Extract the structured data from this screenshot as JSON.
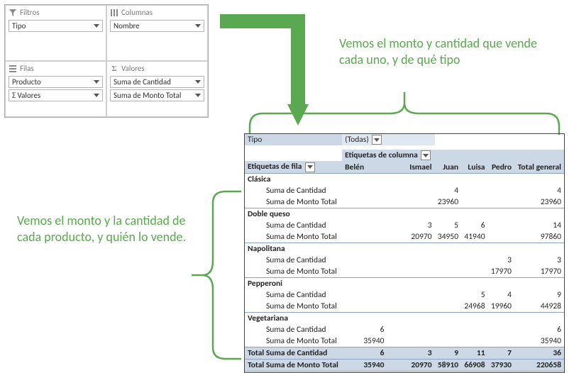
{
  "fieldlist": {
    "zones": {
      "filters": {
        "label": "Filtros",
        "items": [
          "Tipo"
        ]
      },
      "columns": {
        "label": "Columnas",
        "items": [
          "Nombre"
        ]
      },
      "rows": {
        "label": "Filas",
        "items": [
          "Producto",
          "Σ  Valores"
        ]
      },
      "values": {
        "label": "Valores",
        "items": [
          "Suma de Cantidad",
          "Suma de Monto Total"
        ]
      }
    }
  },
  "callouts": {
    "top": "Vemos el monto y cantidad que vende cada uno, y de qué tipo",
    "left": "Vemos el monto y la cantidad de cada producto, y quién lo vende."
  },
  "pivot": {
    "filter_field": "Tipo",
    "filter_value": "(Todas)",
    "col_axis_label": "Etiquetas de columna",
    "row_axis_label": "Etiquetas de fila",
    "columns": [
      "Belén",
      "Ismael",
      "Juan",
      "Luisa",
      "Pedro"
    ],
    "grand_col": "Total general",
    "measure_qty": "Suma de Cantidad",
    "measure_amt": "Suma de Monto Total",
    "rows": [
      {
        "product": "Clásica",
        "qty": [
          "",
          "",
          "4",
          "",
          ""
        ],
        "amt": [
          "",
          "",
          "23960",
          "",
          ""
        ],
        "qty_tot": "4",
        "amt_tot": "23960"
      },
      {
        "product": "Doble queso",
        "qty": [
          "",
          "3",
          "5",
          "6",
          ""
        ],
        "amt": [
          "",
          "20970",
          "34950",
          "41940",
          ""
        ],
        "qty_tot": "14",
        "amt_tot": "97860"
      },
      {
        "product": "Napolitana",
        "qty": [
          "",
          "",
          "",
          "",
          "3"
        ],
        "amt": [
          "",
          "",
          "",
          "",
          "17970"
        ],
        "qty_tot": "3",
        "amt_tot": "17970"
      },
      {
        "product": "Pepperoni",
        "qty": [
          "",
          "",
          "",
          "5",
          "4"
        ],
        "amt": [
          "",
          "",
          "",
          "24968",
          "19960"
        ],
        "qty_tot": "9",
        "amt_tot": "44928"
      },
      {
        "product": "Vegetariana",
        "qty": [
          "6",
          "",
          "",
          "",
          ""
        ],
        "amt": [
          "35940",
          "",
          "",
          "",
          ""
        ],
        "qty_tot": "6",
        "amt_tot": "35940"
      }
    ],
    "grand_qty_label": "Total Suma de Cantidad",
    "grand_amt_label": "Total Suma de Monto Total",
    "grand_qty": [
      "6",
      "3",
      "9",
      "11",
      "7"
    ],
    "grand_amt": [
      "35940",
      "20970",
      "58910",
      "66908",
      "37930"
    ],
    "grand_qty_tot": "36",
    "grand_amt_tot": "220658"
  },
  "chart_data": {
    "type": "table",
    "title": "PivotTable – Suma de Cantidad / Suma de Monto Total por Producto y Nombre",
    "row_field": "Producto",
    "col_field": "Nombre",
    "filter": {
      "field": "Tipo",
      "value": "(Todas)"
    },
    "columns": [
      "Belén",
      "Ismael",
      "Juan",
      "Luisa",
      "Pedro",
      "Total general"
    ],
    "series": [
      {
        "name": "Clásica · Cantidad",
        "values": [
          null,
          null,
          4,
          null,
          null,
          4
        ]
      },
      {
        "name": "Clásica · Monto Total",
        "values": [
          null,
          null,
          23960,
          null,
          null,
          23960
        ]
      },
      {
        "name": "Doble queso · Cantidad",
        "values": [
          null,
          3,
          5,
          6,
          null,
          14
        ]
      },
      {
        "name": "Doble queso · Monto Total",
        "values": [
          null,
          20970,
          34950,
          41940,
          null,
          97860
        ]
      },
      {
        "name": "Napolitana · Cantidad",
        "values": [
          null,
          null,
          null,
          null,
          3,
          3
        ]
      },
      {
        "name": "Napolitana · Monto Total",
        "values": [
          null,
          null,
          null,
          null,
          17970,
          17970
        ]
      },
      {
        "name": "Pepperoni · Cantidad",
        "values": [
          null,
          null,
          null,
          5,
          4,
          9
        ]
      },
      {
        "name": "Pepperoni · Monto Total",
        "values": [
          null,
          null,
          null,
          24968,
          19960,
          44928
        ]
      },
      {
        "name": "Vegetariana · Cantidad",
        "values": [
          6,
          null,
          null,
          null,
          null,
          6
        ]
      },
      {
        "name": "Vegetariana · Monto Total",
        "values": [
          35940,
          null,
          null,
          null,
          null,
          35940
        ]
      },
      {
        "name": "Total · Cantidad",
        "values": [
          6,
          3,
          9,
          11,
          7,
          36
        ]
      },
      {
        "name": "Total · Monto Total",
        "values": [
          35940,
          20970,
          58910,
          66908,
          37930,
          220658
        ]
      }
    ]
  }
}
